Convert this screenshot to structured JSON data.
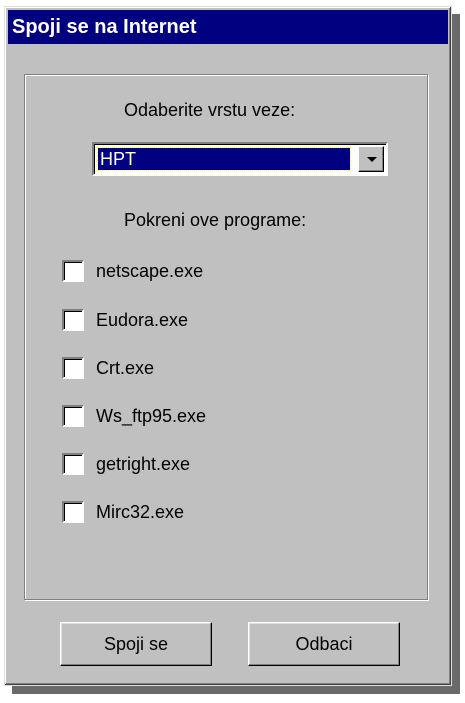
{
  "window": {
    "title": "Spoji se na Internet"
  },
  "connection": {
    "label": "Odaberite vrstu veze:",
    "selected": "HPT"
  },
  "programs": {
    "label": "Pokreni ove programe:",
    "items": [
      {
        "label": "netscape.exe",
        "checked": false
      },
      {
        "label": "Eudora.exe",
        "checked": false
      },
      {
        "label": "Crt.exe",
        "checked": false
      },
      {
        "label": "Ws_ftp95.exe",
        "checked": false
      },
      {
        "label": "getright.exe",
        "checked": false
      },
      {
        "label": "Mirc32.exe",
        "checked": false
      }
    ]
  },
  "buttons": {
    "connect": "Spoji se",
    "cancel": "Odbaci"
  }
}
